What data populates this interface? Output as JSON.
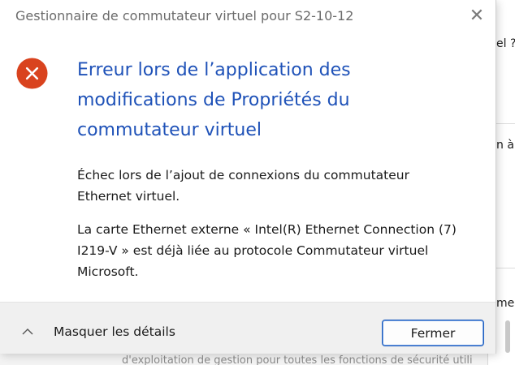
{
  "window": {
    "title": "Gestionnaire de commutateur virtuel pour S2-10-12",
    "close_glyph": "✕"
  },
  "dialog": {
    "heading": "Erreur lors de l’application des modifications de Propriétés du commutateur virtuel",
    "message_1": "Échec lors de l’ajout de connexions du commutateur Ethernet virtuel.",
    "message_2": "La carte Ethernet externe « Intel(R) Ethernet Connection (7) I219-V » est déjà liée au protocole Commutateur virtuel Microsoft."
  },
  "footer": {
    "details_label": "Masquer les détails",
    "close_label": "Fermer"
  },
  "background": {
    "fragment_1": "el ?",
    "fragment_2": "n à",
    "fragment_3": "me",
    "bottom_fragment": "d'exploitation de gestion pour toutes les fonctions de sécurité utili"
  },
  "colors": {
    "accent": "#1f52b8",
    "error": "#d9431e"
  },
  "icons": {
    "error": "error-icon",
    "close": "close-icon",
    "chevron": "chevron-up-icon"
  }
}
